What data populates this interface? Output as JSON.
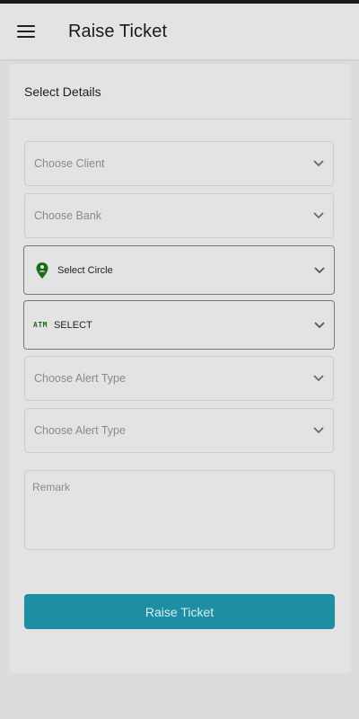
{
  "appbar": {
    "title": "Raise Ticket",
    "menu_icon": "hamburger-menu-icon"
  },
  "form": {
    "section_title": "Select Details",
    "client": {
      "placeholder": "Choose Client"
    },
    "bank": {
      "placeholder": "Choose Bank"
    },
    "circle": {
      "value": "Select Circle",
      "icon": "location-pin-icon"
    },
    "atm": {
      "icon_text": "ATM",
      "value": "SELECT"
    },
    "alert_type_1": {
      "placeholder": "Choose Alert Type"
    },
    "alert_type_2": {
      "placeholder": "Choose Alert Type"
    },
    "remark": {
      "placeholder": "Remark",
      "value": ""
    },
    "submit_label": "Raise Ticket"
  },
  "colors": {
    "accent": "#1e8ea3",
    "icon_green": "#1b6b1b",
    "background": "#dcdcdc"
  }
}
